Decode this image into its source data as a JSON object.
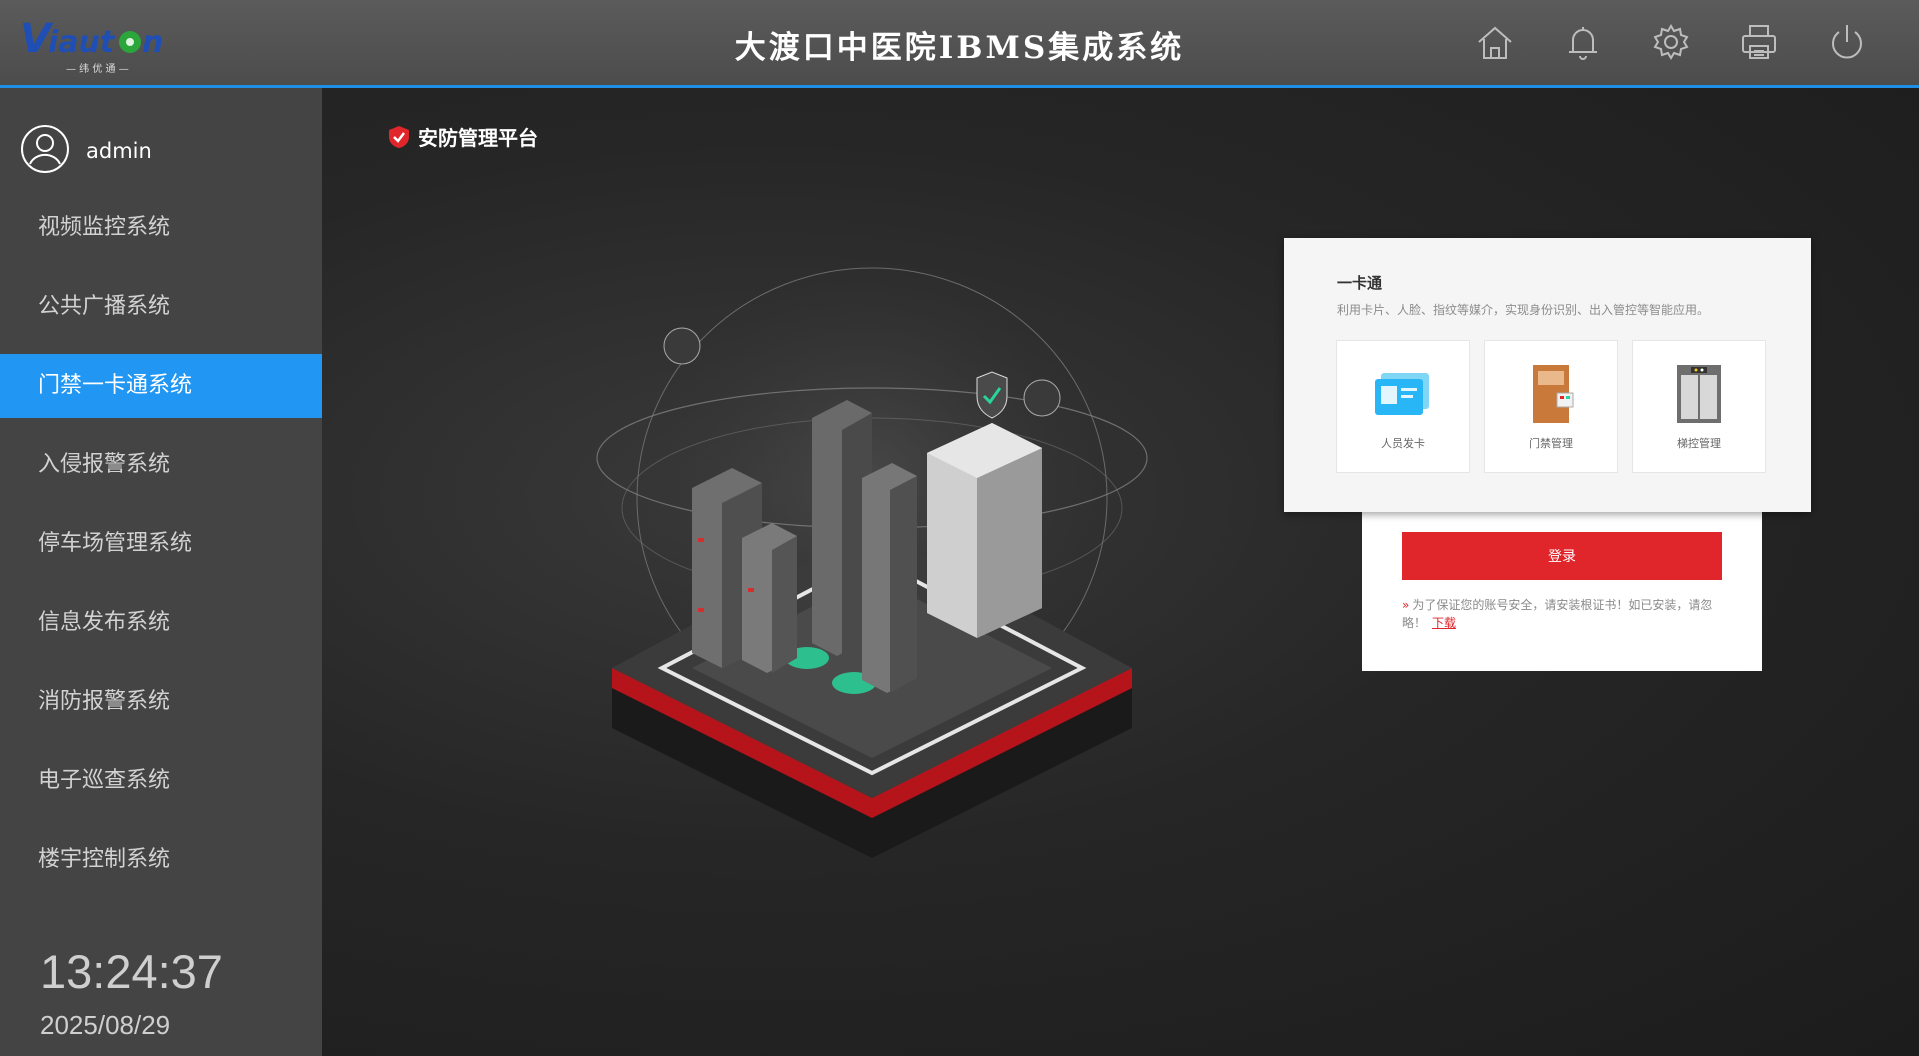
{
  "header": {
    "title": "大渡口中医院IBMS集成系统",
    "logo_text": "Viauton",
    "logo_subtext": "— 纬 优 通 —",
    "icons": [
      "home-icon",
      "bell-icon",
      "gear-icon",
      "printer-icon",
      "power-icon"
    ]
  },
  "sidebar": {
    "user": "admin",
    "items": [
      {
        "label": "视频监控系统",
        "active": false
      },
      {
        "label": "公共广播系统",
        "active": false
      },
      {
        "label": "门禁一卡通系统",
        "active": true
      },
      {
        "label": "入侵报警系统",
        "active": false
      },
      {
        "label": "停车场管理系统",
        "active": false
      },
      {
        "label": "信息发布系统",
        "active": false
      },
      {
        "label": "消防报警系统",
        "active": false
      },
      {
        "label": "电子巡查系统",
        "active": false
      },
      {
        "label": "楼宇控制系统",
        "active": false
      }
    ],
    "clock": "13:24:37",
    "date": "2025/08/29"
  },
  "main": {
    "platform_name": "安防管理平台",
    "card": {
      "title": "一卡通",
      "description": "利用卡片、人脸、指纹等媒介，实现身份识别、出入管控等智能应用。",
      "tiles": [
        {
          "label": "人员发卡",
          "icon": "id-card-icon"
        },
        {
          "label": "门禁管理",
          "icon": "door-icon"
        },
        {
          "label": "梯控管理",
          "icon": "elevator-icon"
        }
      ]
    },
    "login": {
      "button_label": "登录",
      "notice_text": "为了保证您的账号安全，请安装根证书！如已安装，请忽略！",
      "download_link": "下载"
    }
  },
  "colors": {
    "accent_blue": "#2196f3",
    "brand_red": "#e0262b",
    "sidebar_bg": "#444444",
    "main_bg": "#1c1c1c"
  }
}
